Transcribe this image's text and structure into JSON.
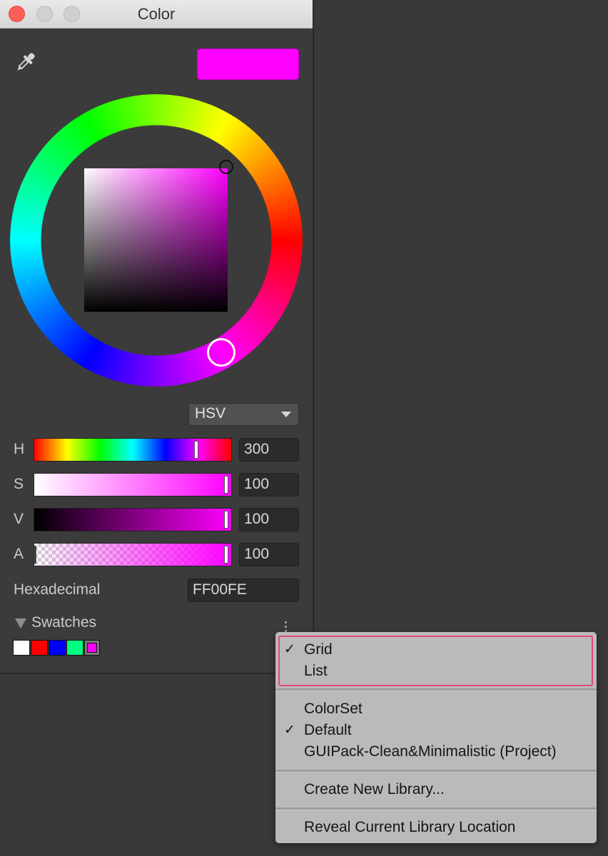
{
  "window": {
    "title": "Color"
  },
  "preview": {
    "color": "#ff00fe"
  },
  "picker": {
    "hue": 300,
    "saturation": 100,
    "value": 100
  },
  "mode": {
    "selected": "HSV"
  },
  "channels": [
    {
      "label": "H",
      "value": "300",
      "fraction": 0.83
    },
    {
      "label": "S",
      "value": "100",
      "fraction": 1.0
    },
    {
      "label": "V",
      "value": "100",
      "fraction": 1.0
    },
    {
      "label": "A",
      "value": "100",
      "fraction": 1.0
    }
  ],
  "hex": {
    "label": "Hexadecimal",
    "value": "FF00FE"
  },
  "swatches": {
    "title": "Swatches",
    "colors": [
      "#ffffff",
      "#ff0000",
      "#0000ff",
      "#00ff7f",
      "#ff00fe"
    ]
  },
  "menu": {
    "view_items": [
      {
        "label": "Grid",
        "checked": true
      },
      {
        "label": "List",
        "checked": false
      }
    ],
    "library_items": [
      {
        "label": "ColorSet",
        "checked": false
      },
      {
        "label": "Default",
        "checked": true
      },
      {
        "label": "GUIPack-Clean&Minimalistic (Project)",
        "checked": false
      }
    ],
    "create_label": "Create New Library...",
    "reveal_label": "Reveal Current Library Location",
    "checkmark": "✓"
  }
}
